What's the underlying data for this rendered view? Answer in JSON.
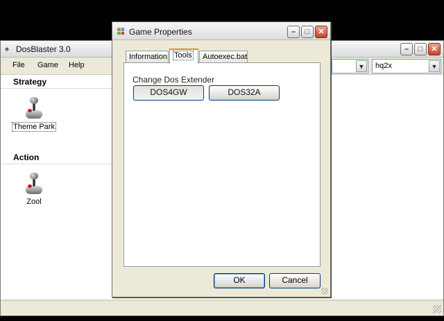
{
  "main_window": {
    "title": "DosBlaster 3.0",
    "menu": [
      "File",
      "Game",
      "Help"
    ],
    "combo_left": {
      "value": ""
    },
    "combo_right": {
      "value": "hq2x"
    },
    "groups": [
      {
        "name": "Strategy",
        "games": [
          {
            "label": "Theme Park",
            "selected": true
          }
        ]
      },
      {
        "name": "Action",
        "games": [
          {
            "label": "Zool",
            "selected": false
          }
        ]
      }
    ]
  },
  "dialog": {
    "title": "Game Properties",
    "tabs": [
      {
        "label": "Information",
        "active": false
      },
      {
        "label": "Tools",
        "active": true
      },
      {
        "label": "Autoexec.bat",
        "active": false
      }
    ],
    "tools": {
      "label": "Change Dos Extender",
      "buttons": [
        "DOS4GW",
        "DOS32A"
      ]
    },
    "ok_label": "OK",
    "cancel_label": "Cancel"
  },
  "icons": {
    "minimize": "minimize-icon",
    "maximize": "maximize-icon",
    "close": "close-icon",
    "game": "joystick-icon"
  }
}
